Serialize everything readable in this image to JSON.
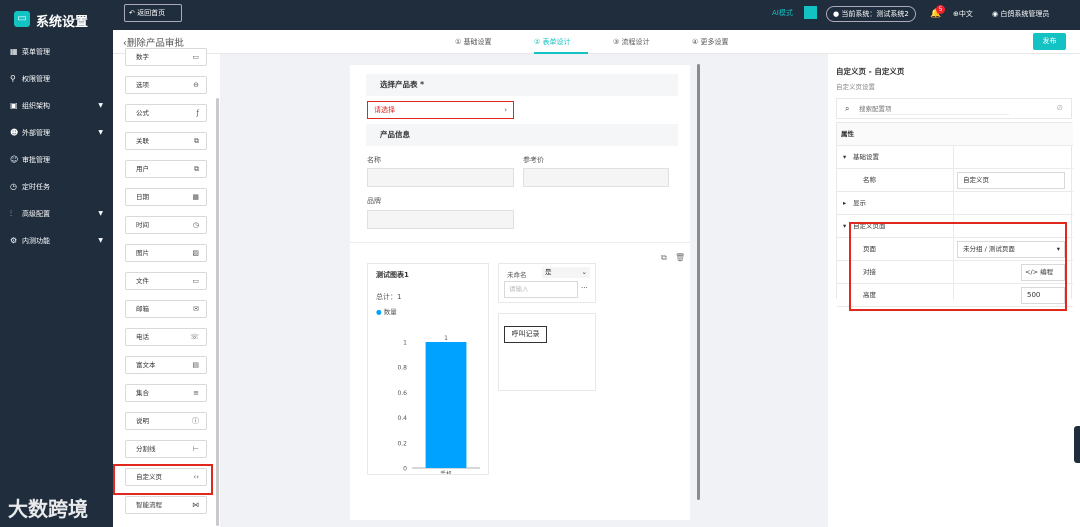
{
  "app": {
    "title": "系统设置",
    "logo_icon": "monitor-icon"
  },
  "topbar": {
    "back_label": "返回首页",
    "ai_mode": "AI模式",
    "current_system": "当前系统：测试系统2",
    "notif_count": "5",
    "language": "中文",
    "user": "白鸽系统管理员"
  },
  "sidebar": {
    "items": [
      {
        "label": "菜单管理",
        "icon": "grid-icon",
        "expand": false
      },
      {
        "label": "权限管理",
        "icon": "user-lock-icon",
        "expand": false
      },
      {
        "label": "组织架构",
        "icon": "org-icon",
        "expand": true
      },
      {
        "label": "外部管理",
        "icon": "users-icon",
        "expand": true
      },
      {
        "label": "审批管理",
        "icon": "user-icon",
        "expand": false
      },
      {
        "label": "定时任务",
        "icon": "clock-icon",
        "expand": false
      },
      {
        "label": "高级配置",
        "icon": "sliders-icon",
        "expand": true
      },
      {
        "label": "内测功能",
        "icon": "gear-icon",
        "expand": true
      }
    ]
  },
  "subheader": {
    "page_title": "删除产品审批",
    "steps": [
      "① 基础设置",
      "② 表单设计",
      "③ 流程设计",
      "④ 更多设置"
    ],
    "active_step": 1,
    "publish_label": "发布"
  },
  "palette": {
    "items": [
      {
        "label": "数字",
        "icon": "number-icon"
      },
      {
        "label": "选项",
        "icon": "dropdown-icon"
      },
      {
        "label": "公式",
        "icon": "formula-icon"
      },
      {
        "label": "关联",
        "icon": "link-icon"
      },
      {
        "label": "用户",
        "icon": "user-copy-icon"
      },
      {
        "label": "日期",
        "icon": "calendar-icon"
      },
      {
        "label": "时间",
        "icon": "clock-icon"
      },
      {
        "label": "图片",
        "icon": "image-icon"
      },
      {
        "label": "文件",
        "icon": "folder-icon"
      },
      {
        "label": "邮箱",
        "icon": "mail-icon"
      },
      {
        "label": "电话",
        "icon": "phone-icon"
      },
      {
        "label": "富文本",
        "icon": "doc-icon"
      },
      {
        "label": "集合",
        "icon": "list-icon"
      },
      {
        "label": "说明",
        "icon": "info-icon"
      },
      {
        "label": "分割线",
        "icon": "divider-icon"
      },
      {
        "label": "自定义页",
        "icon": "code-icon"
      },
      {
        "label": "智能流程",
        "icon": "share-icon"
      }
    ]
  },
  "form": {
    "section1_title": "选择产品表 *",
    "select_placeholder": "请选择",
    "section2_title": "产品信息",
    "field_name": "名称",
    "field_ref_price": "参考价",
    "field_brand": "品牌"
  },
  "chart_widget": {
    "title": "测试图表1",
    "total": "总计：1"
  },
  "chart_data": {
    "type": "bar",
    "categories": [
      "手机"
    ],
    "series": [
      {
        "name": "数量",
        "values": [
          1
        ],
        "color": "#00a2ff"
      }
    ],
    "ylim": [
      0,
      1
    ],
    "yticks": [
      "0",
      "0.2",
      "0.4",
      "0.6",
      "0.8",
      "1"
    ],
    "data_labels": [
      "1"
    ]
  },
  "filter_widget": {
    "field": "未命名",
    "op": "是",
    "placeholder": "请输入",
    "more": "···"
  },
  "call_button": "呼叫记录",
  "props": {
    "title": "自定义页 - 自定义页",
    "subtitle": "自定义页设置",
    "search_placeholder": "搜索配置项",
    "column_header": "属性",
    "group_basic": "基础设置",
    "name_label": "名称",
    "name_value": "自定义页",
    "group_display": "显示",
    "group_custom": "自定义页面",
    "page_label": "页面",
    "page_value": "未分组 / 测试页面",
    "dock_label": "对接",
    "edit_label": "编程",
    "height_label": "高度",
    "height_value": "500"
  },
  "watermark": "大数跨境"
}
